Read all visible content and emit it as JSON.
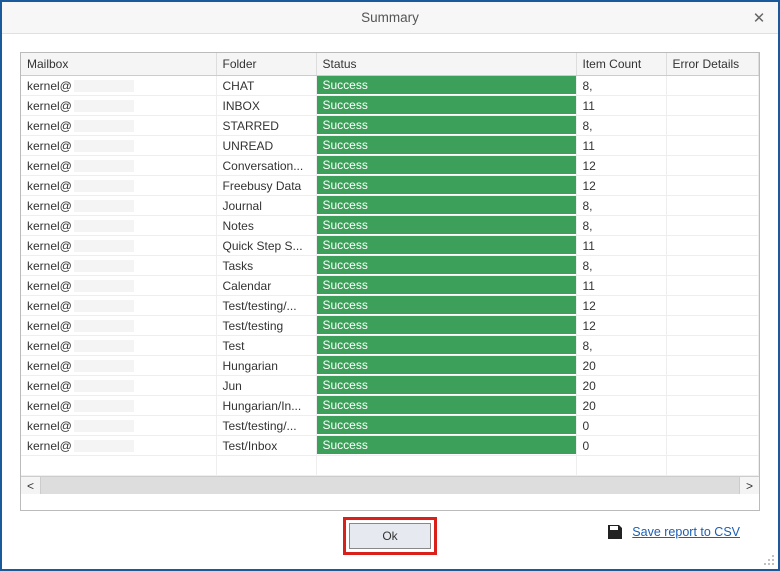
{
  "window": {
    "title": "Summary",
    "close_glyph": "✕"
  },
  "columns": {
    "mailbox": "Mailbox",
    "folder": "Folder",
    "status": "Status",
    "item_count": "Item Count",
    "error_details": "Error Details"
  },
  "mailbox_prefix": "kernel@",
  "rows": [
    {
      "folder": "CHAT",
      "status": "Success",
      "count": "8,"
    },
    {
      "folder": "INBOX",
      "status": "Success",
      "count": "11"
    },
    {
      "folder": "STARRED",
      "status": "Success",
      "count": "8,"
    },
    {
      "folder": "UNREAD",
      "status": "Success",
      "count": "11"
    },
    {
      "folder": "Conversation...",
      "status": "Success",
      "count": "12"
    },
    {
      "folder": "Freebusy Data",
      "status": "Success",
      "count": "12"
    },
    {
      "folder": "Journal",
      "status": "Success",
      "count": "8,"
    },
    {
      "folder": "Notes",
      "status": "Success",
      "count": "8,"
    },
    {
      "folder": "Quick Step S...",
      "status": "Success",
      "count": "11"
    },
    {
      "folder": "Tasks",
      "status": "Success",
      "count": "8,"
    },
    {
      "folder": "Calendar",
      "status": "Success",
      "count": "11"
    },
    {
      "folder": "Test/testing/...",
      "status": "Success",
      "count": "12"
    },
    {
      "folder": "Test/testing",
      "status": "Success",
      "count": "12"
    },
    {
      "folder": "Test",
      "status": "Success",
      "count": "8,"
    },
    {
      "folder": "Hungarian",
      "status": "Success",
      "count": "20"
    },
    {
      "folder": "Jun",
      "status": "Success",
      "count": "20"
    },
    {
      "folder": "Hungarian/In...",
      "status": "Success",
      "count": "20"
    },
    {
      "folder": "Test/testing/...",
      "status": "Success",
      "count": "0"
    },
    {
      "folder": "Test/Inbox",
      "status": "Success",
      "count": "0"
    }
  ],
  "scroll": {
    "left_glyph": "<",
    "right_glyph": ">"
  },
  "footer": {
    "ok_label": "Ok",
    "save_label": "Save report to CSV"
  },
  "status_color": "#3da05a"
}
